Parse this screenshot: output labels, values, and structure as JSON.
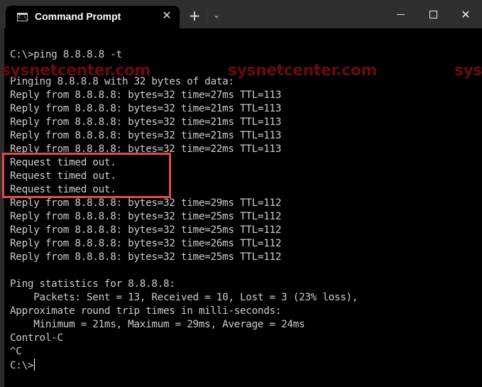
{
  "window": {
    "tab_title": "Command Prompt",
    "tab_icon": "cmd-icon",
    "tab_icon_text": "C:\\_",
    "tab_close_glyph": "✕",
    "new_tab_glyph": "+",
    "dropdown_glyph": "⌄",
    "close_glyph": "✕"
  },
  "watermark": {
    "text": "sysnetcenter.com",
    "color": "#7a0d14"
  },
  "highlight_color": "#e24c4c",
  "terminal": {
    "lines": [
      "C:\\>ping 8.8.8.8 -t",
      "",
      "Pinging 8.8.8.8 with 32 bytes of data:",
      "Reply from 8.8.8.8: bytes=32 time=27ms TTL=113",
      "Reply from 8.8.8.8: bytes=32 time=21ms TTL=113",
      "Reply from 8.8.8.8: bytes=32 time=21ms TTL=113",
      "Reply from 8.8.8.8: bytes=32 time=21ms TTL=113",
      "Reply from 8.8.8.8: bytes=32 time=22ms TTL=113",
      "Request timed out.",
      "Request timed out.",
      "Request timed out.",
      "Reply from 8.8.8.8: bytes=32 time=29ms TTL=112",
      "Reply from 8.8.8.8: bytes=32 time=25ms TTL=112",
      "Reply from 8.8.8.8: bytes=32 time=25ms TTL=112",
      "Reply from 8.8.8.8: bytes=32 time=26ms TTL=112",
      "Reply from 8.8.8.8: bytes=32 time=25ms TTL=112",
      "",
      "Ping statistics for 8.8.8.8:",
      "    Packets: Sent = 13, Received = 10, Lost = 3 (23% loss),",
      "Approximate round trip times in milli-seconds:",
      "    Minimum = 21ms, Maximum = 29ms, Average = 24ms",
      "Control-C",
      "^C",
      "C:\\>"
    ]
  }
}
